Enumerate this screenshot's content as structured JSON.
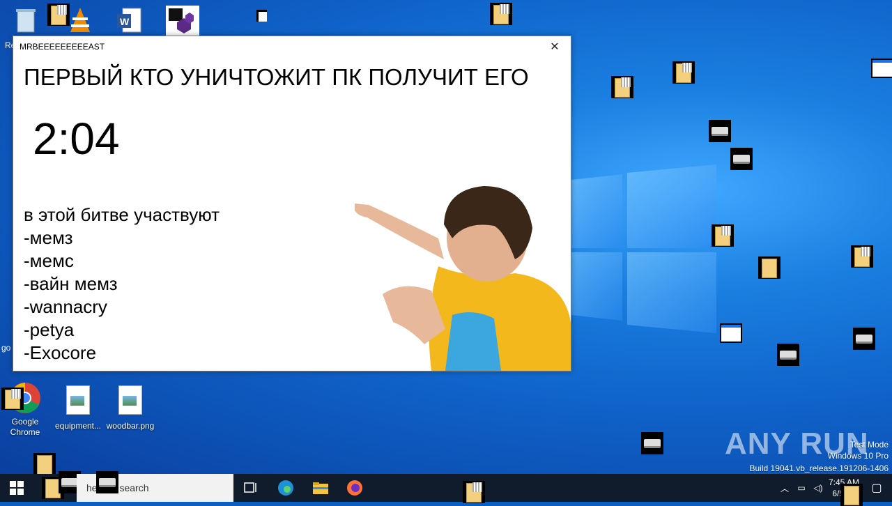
{
  "desktop": {
    "icons": [
      {
        "label": "Google Chrome"
      },
      {
        "label": "equipment..."
      },
      {
        "label": "woodbar.png"
      }
    ],
    "partial_labels": {
      "left_re": "Re",
      "left_go": "go"
    }
  },
  "window": {
    "title": "MRBEEEEEEEEEAST",
    "close_glyph": "✕",
    "headline": "ПЕРВЫЙ КТО УНИЧТОЖИТ ПК ПОЛУЧИТ ЕГО",
    "timer": "2:04",
    "participants_heading": "в этой битве участвуют",
    "participants": [
      "-мемз",
      "-мемс",
      "-вайн мемз",
      "-wannacry",
      "-petya",
      "-Exocore"
    ]
  },
  "taskbar": {
    "search_placeholder": "here to search",
    "clock_time": "7:45 AM",
    "clock_date": "6/5/20"
  },
  "watermark": {
    "brand": "ANY RUN",
    "line1": "Test Mode",
    "line2": "Windows 10 Pro",
    "line3": "Build 19041.vb_release.191206-1406"
  },
  "colors": {
    "accent": "#1a73e8",
    "taskbar": "#101b2b",
    "folder": "#f2d07e"
  }
}
